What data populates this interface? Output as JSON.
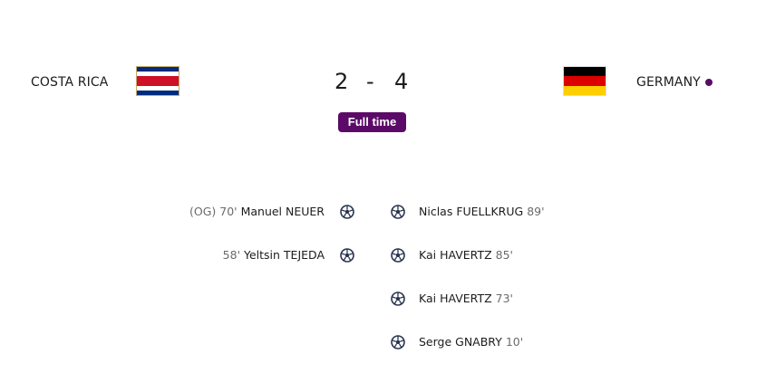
{
  "match": {
    "home_team": "COSTA RICA",
    "away_team": "GERMANY",
    "home_score": "2",
    "separator": "-",
    "away_score": "4",
    "status": "Full time"
  },
  "colors": {
    "accent": "#5b0a67",
    "costa_rica_flag": [
      "#002b7f",
      "#ffffff",
      "#ce1126",
      "#ffffff",
      "#002b7f"
    ],
    "germany_flag": [
      "#000000",
      "#dd0000",
      "#ffce00"
    ]
  },
  "goals": {
    "home": [
      {
        "og_label": "(OG)",
        "minute": "70'",
        "player": "Manuel NEUER",
        "icon": "soccer-ball-icon"
      },
      {
        "og_label": "",
        "minute": "58'",
        "player": "Yeltsin TEJEDA",
        "icon": "soccer-ball-icon"
      }
    ],
    "away": [
      {
        "player": "Niclas FUELLKRUG",
        "minute": "89'",
        "icon": "soccer-ball-icon"
      },
      {
        "player": "Kai HAVERTZ",
        "minute": "85'",
        "icon": "soccer-ball-icon"
      },
      {
        "player": "Kai HAVERTZ",
        "minute": "73'",
        "icon": "soccer-ball-icon"
      },
      {
        "player": "Serge GNABRY",
        "minute": "10'",
        "icon": "soccer-ball-icon"
      }
    ]
  }
}
